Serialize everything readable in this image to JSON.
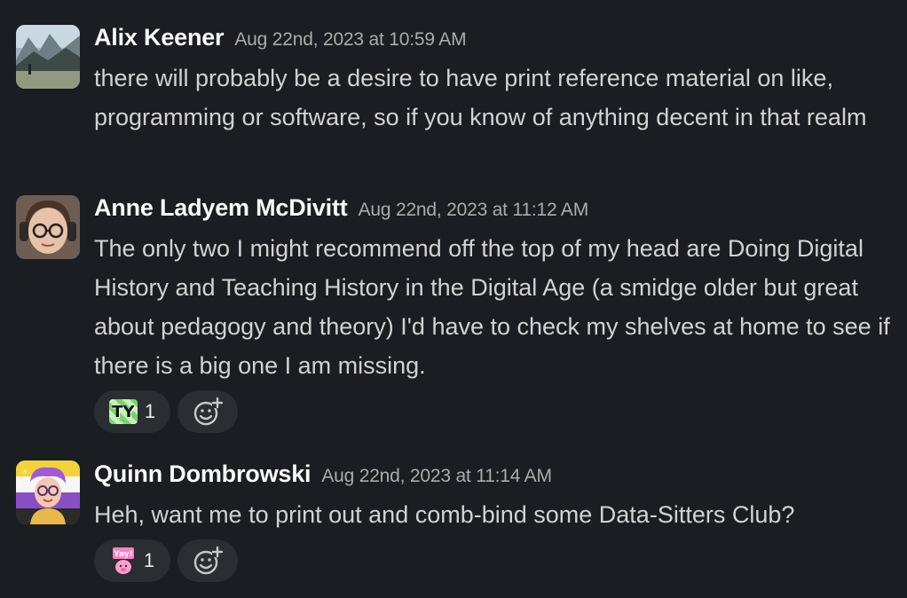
{
  "messages": [
    {
      "author": "Alix Keener",
      "timestamp": "Aug 22nd, 2023 at 10:59 AM",
      "text": "there will probably be a desire to have print reference material on like, programming or software, so if you know of anything decent in that realm",
      "reactions": []
    },
    {
      "author": "Anne Ladyem McDivitt",
      "timestamp": "Aug 22nd, 2023 at 11:12 AM",
      "text": "The only two I might recommend off the top of my head are Doing Digital History and Teaching History in the Digital Age (a smidge older but great about pedagogy and theory) I'd have to check my shelves at home to see if there is a big one I am missing.",
      "reactions": [
        {
          "emoji": "ty",
          "emoji_text": "TY",
          "count": "1"
        }
      ]
    },
    {
      "author": "Quinn Dombrowski",
      "timestamp": "Aug 22nd, 2023 at 11:14 AM",
      "text": "Heh, want me to print out and comb-bind some Data-Sitters Club?",
      "reactions": [
        {
          "emoji": "yay",
          "emoji_text": "Yay!",
          "count": "1"
        }
      ]
    }
  ],
  "icons": {
    "add_reaction": "add-reaction-icon"
  },
  "colors": {
    "background": "#1a1d21",
    "author": "#f8f8f8",
    "text": "#d1d2d3",
    "timestamp": "#ababad",
    "reaction_pill": "#2a2d31"
  }
}
